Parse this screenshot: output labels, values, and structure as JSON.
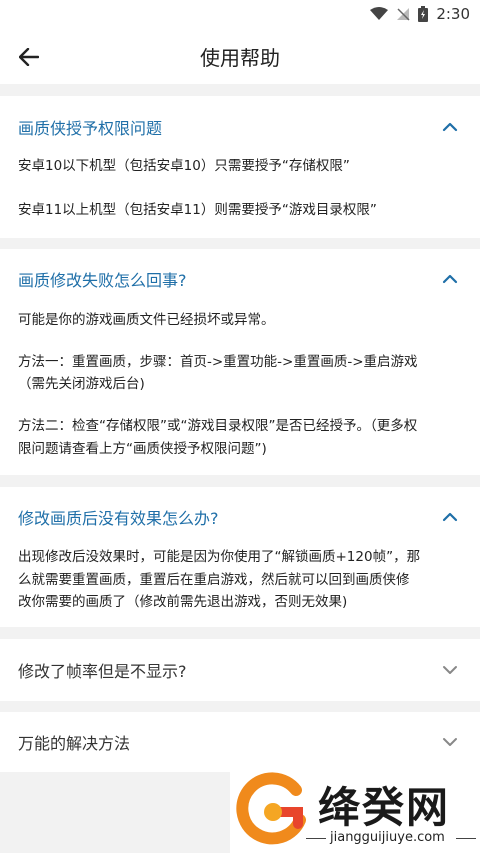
{
  "status": {
    "time": "2:30"
  },
  "header": {
    "title": "使用帮助"
  },
  "faq": [
    {
      "question": "画质侠授予权限问题",
      "expanded": true,
      "answer_lines": [
        "安卓10以下机型（包括安卓10）只需要授予“存储权限”",
        "安卓11以上机型（包括安卓11）则需要授予“游戏目录权限”"
      ]
    },
    {
      "question": "画质修改失败怎么回事?",
      "expanded": true,
      "answer_lines": [
        "可能是你的游戏画质文件已经损坏或异常。",
        "方法一：重置画质，步骤：首页->重置功能->重置画质->重启游戏",
        "（需先关闭游戏后台)",
        "方法二：检查“存储权限”或“游戏目录权限”是否已经授予。（更多权",
        "限问题请查看上方“画质侠授予权限问题”)"
      ]
    },
    {
      "question": "修改画质后没有效果怎么办?",
      "expanded": true,
      "answer_lines": [
        "出现修改后没效果时，可能是因为你使用了“解锁画质+120帧”，那",
        "么就需要重置画质，重置后在重启游戏，然后就可以回到画质侠修",
        "改你需要的画质了（修改前需先退出游戏，否则无效果)"
      ]
    },
    {
      "question": "修改了帧率但是不显示?",
      "expanded": false
    },
    {
      "question": "万能的解决方法",
      "expanded": false
    }
  ],
  "watermark": {
    "name": "绛癸网",
    "url": "jiangguijiuye.com"
  },
  "colors": {
    "accent": "#1f6fa8",
    "logo_orange": "#f08a1c",
    "logo_red": "#e8452c"
  }
}
